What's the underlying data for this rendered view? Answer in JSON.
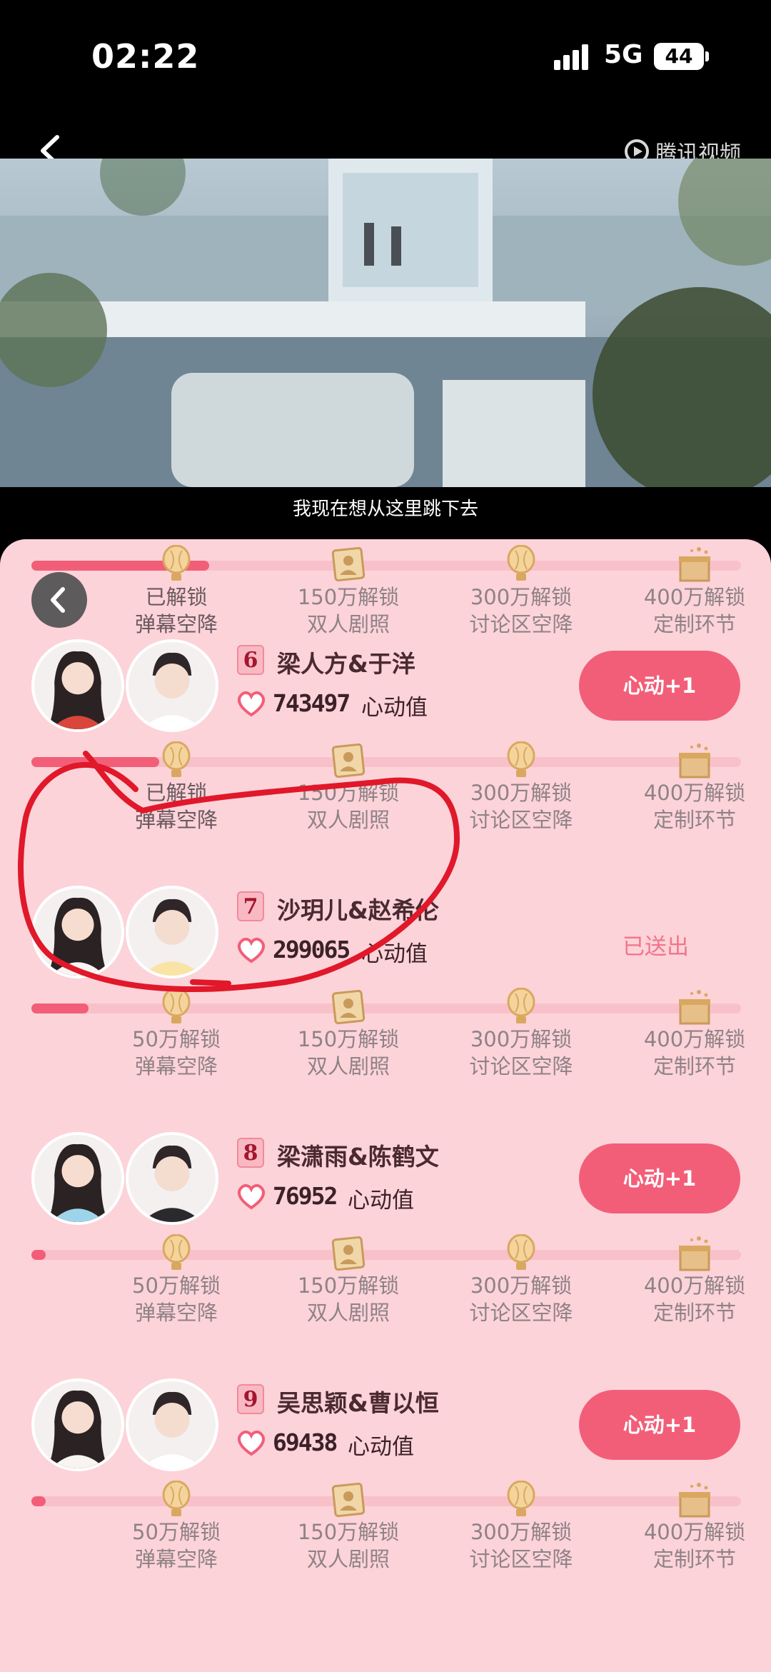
{
  "status": {
    "time": "02:22",
    "network": "5G",
    "battery": "44"
  },
  "video": {
    "platform": "腾讯视频",
    "subtitle": "我现在想从这里跳下去"
  },
  "milestones": [
    "已解锁\n弹幕空降",
    "150万解锁\n双人剧照",
    "300万解锁\n讨论区空降",
    "400万解锁\n定制环节"
  ],
  "top_row": {
    "labels": [
      "已解锁",
      "弹幕空降",
      "150万解锁",
      "双人剧照",
      "300万解锁",
      "讨论区空降",
      "400万解锁",
      "定制环节"
    ],
    "progress": 0.25
  },
  "couples": [
    {
      "rank": "6",
      "names": "梁人方&于洋",
      "score": "743497",
      "unit": "心动值",
      "action": "心动+1",
      "progress": 0.18,
      "labels": [
        "已解锁",
        "弹幕空降",
        "150万解锁",
        "双人剧照",
        "300万解锁",
        "讨论区空降",
        "400万解锁",
        "定制环节"
      ]
    },
    {
      "rank": "7",
      "names": "沙玥儿&赵希伦",
      "score": "299065",
      "unit": "心动值",
      "action": "已送出",
      "progress": 0.08,
      "labels": [
        "50万解锁",
        "弹幕空降",
        "150万解锁",
        "双人剧照",
        "300万解锁",
        "讨论区空降",
        "400万解锁",
        "定制环节"
      ]
    },
    {
      "rank": "8",
      "names": "梁潇雨&陈鹤文",
      "score": "76952",
      "unit": "心动值",
      "action": "心动+1",
      "progress": 0.02,
      "labels": [
        "50万解锁",
        "弹幕空降",
        "150万解锁",
        "双人剧照",
        "300万解锁",
        "讨论区空降",
        "400万解锁",
        "定制环节"
      ]
    },
    {
      "rank": "9",
      "names": "吴思颖&曹以恒",
      "score": "69438",
      "unit": "心动值",
      "action": "心动+1",
      "progress": 0.02,
      "labels": [
        "50万解锁",
        "弹幕空降",
        "150万解锁",
        "双人剧照",
        "300万解锁",
        "讨论区空降",
        "400万解锁",
        "定制环节"
      ]
    }
  ],
  "icons": [
    "balloon-icon",
    "photo-icon",
    "balloon-icon",
    "gift-box-icon"
  ],
  "colors": {
    "accent": "#f25e78",
    "panel": "#fcd3d9",
    "annotation": "#e0182a"
  }
}
